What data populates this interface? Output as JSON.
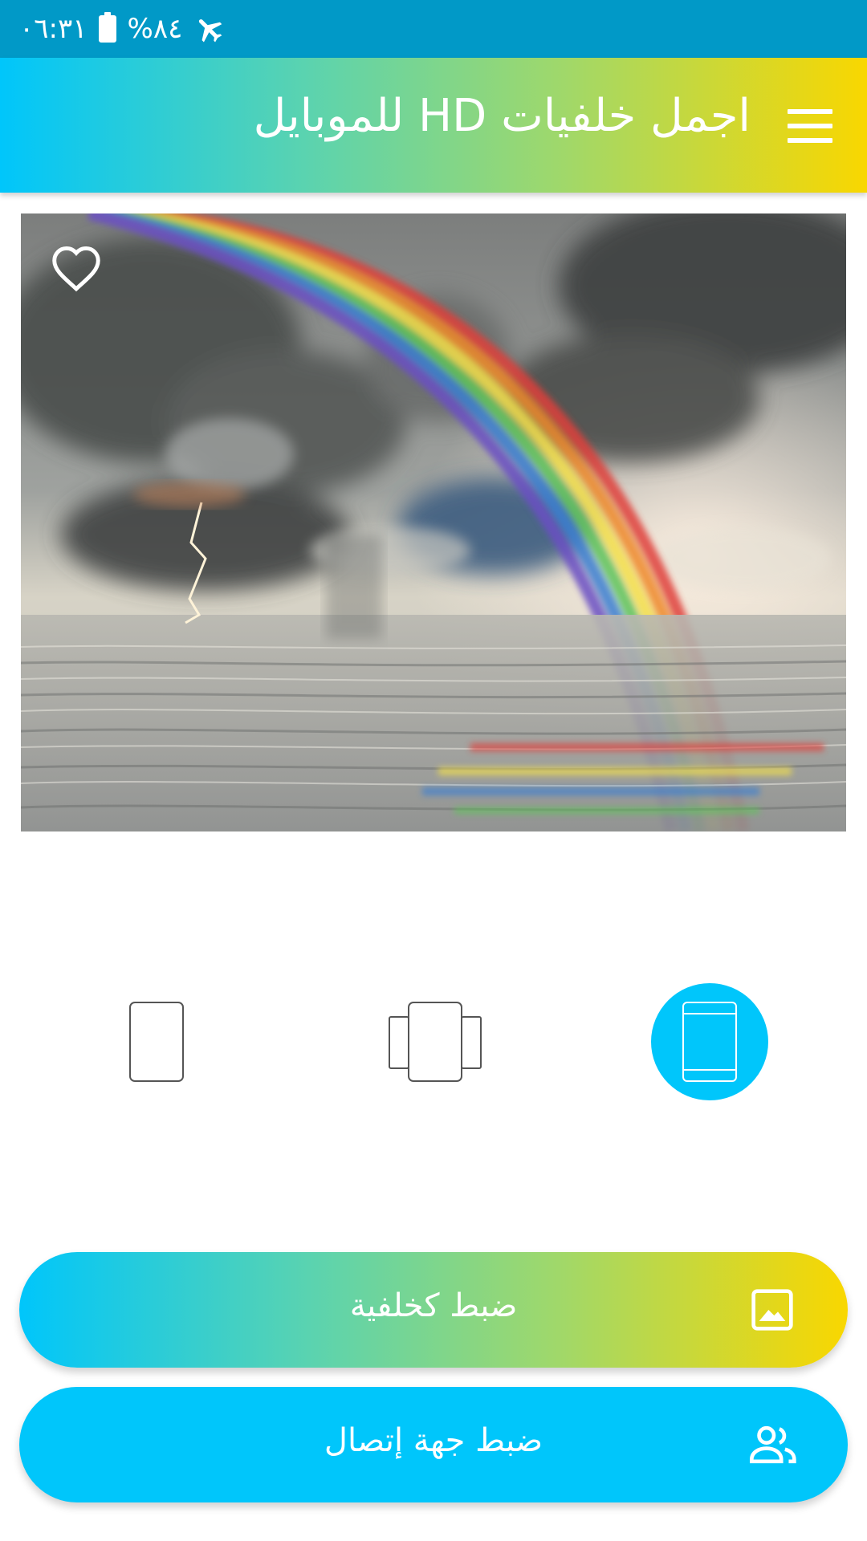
{
  "status_bar": {
    "time": "٠٦:٣١",
    "battery": "%٨٤",
    "icons": [
      "airplane-mode-icon",
      "battery-icon"
    ]
  },
  "app_bar": {
    "title": "اجمل خلفيات HD للموبايل",
    "menu_icon": "hamburger-menu-icon"
  },
  "wallpaper": {
    "description_icon": "heart-outline-icon"
  },
  "screen_options": [
    {
      "id": "home",
      "icon": "single-phone-icon",
      "selected": false
    },
    {
      "id": "both",
      "icon": "multi-screen-icon",
      "selected": false
    },
    {
      "id": "lock",
      "icon": "phone-screen-icon",
      "selected": true
    }
  ],
  "buttons": {
    "set_wallpaper": "ضبط كخلفية",
    "set_contact": "ضبط جهة إتصال"
  },
  "colors": {
    "status_bar": "#0199c7",
    "accent": "#00c6fb",
    "gradient_start": "#00c6fb",
    "gradient_end": "#f9d700"
  }
}
